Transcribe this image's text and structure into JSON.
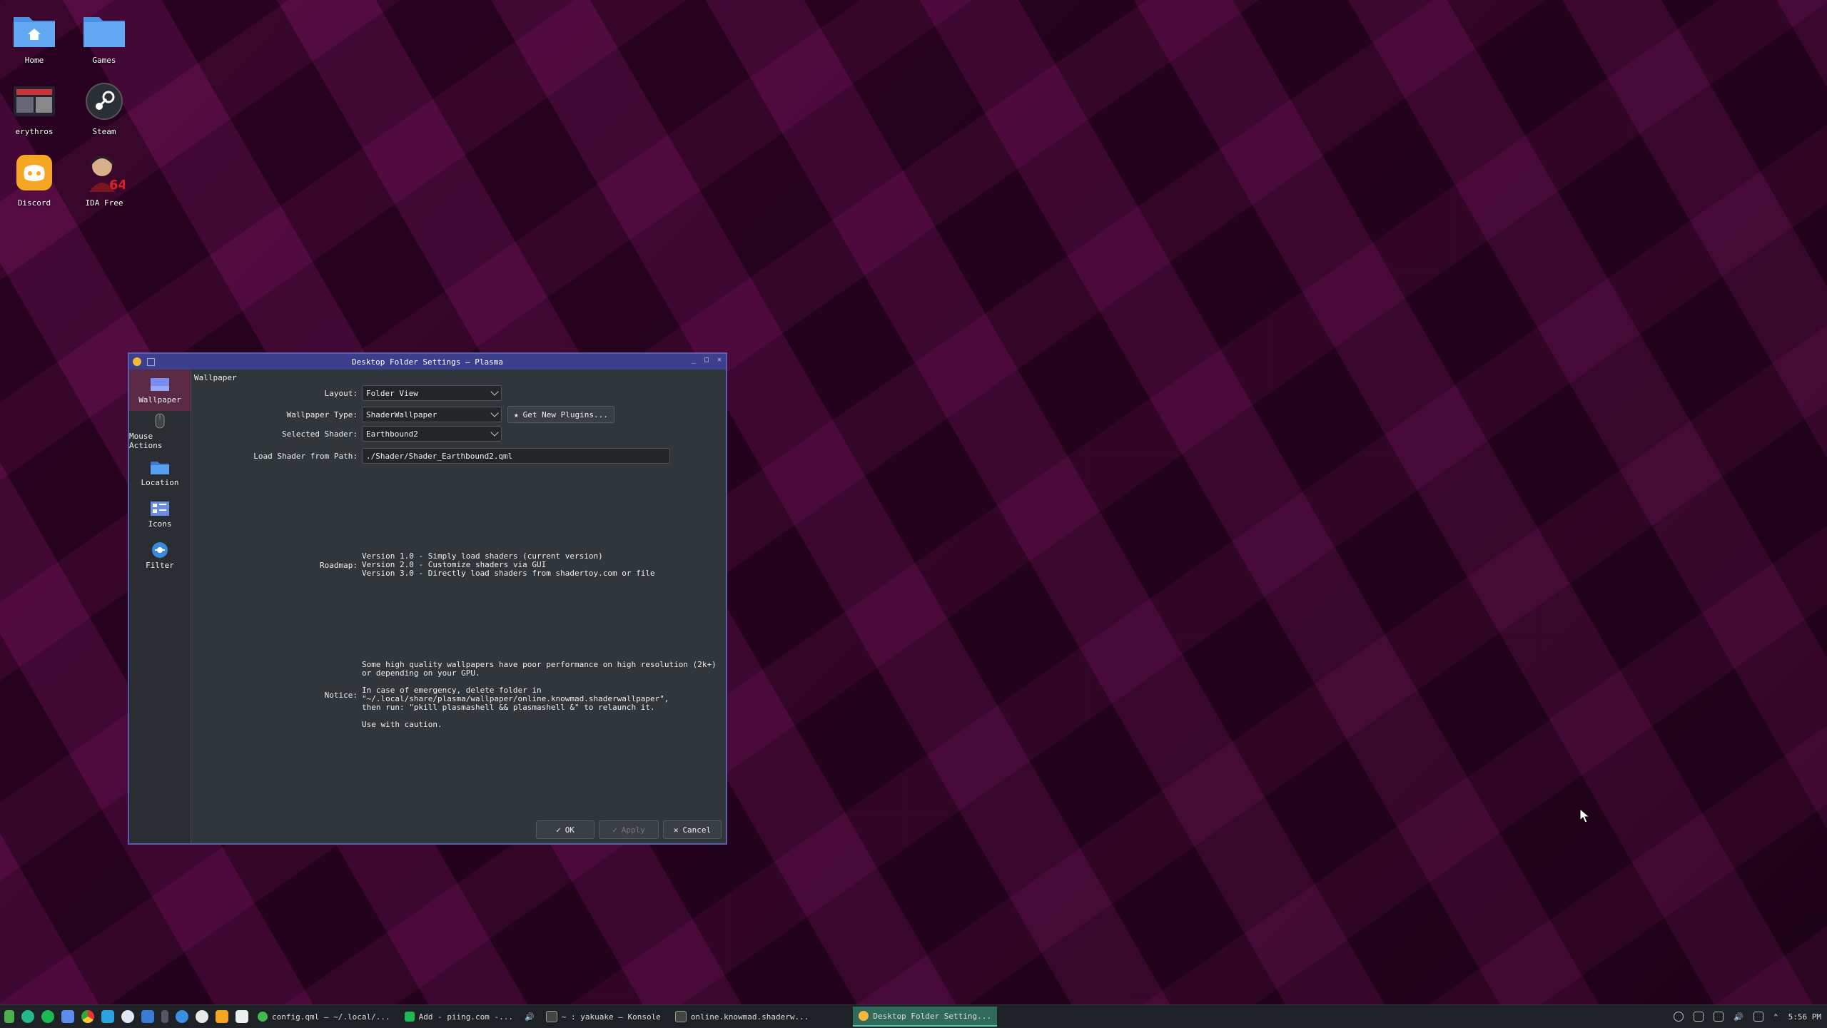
{
  "desktop": {
    "icons": [
      {
        "label": "Home"
      },
      {
        "label": "Games"
      },
      {
        "label": "erythros"
      },
      {
        "label": "Steam"
      },
      {
        "label": "Discord"
      },
      {
        "label": "IDA Free"
      }
    ]
  },
  "window": {
    "title": "Desktop Folder Settings — Plasma",
    "sidebar": [
      {
        "label": "Wallpaper"
      },
      {
        "label": "Mouse Actions"
      },
      {
        "label": "Location"
      },
      {
        "label": "Icons"
      },
      {
        "label": "Filter"
      }
    ],
    "section_title": "Wallpaper",
    "layout": {
      "label": "Layout:",
      "value": "Folder View"
    },
    "wallpaper_type": {
      "label": "Wallpaper Type:",
      "value": "ShaderWallpaper",
      "get_plugins": "Get New Plugins..."
    },
    "selected_shader": {
      "label": "Selected Shader:",
      "value": "Earthbound2"
    },
    "load_path": {
      "label": "Load Shader from Path:",
      "value": "./Shader/Shader_Earthbound2.qml"
    },
    "roadmap": {
      "label": "Roadmap:",
      "lines": [
        "Version 1.0 - Simply load shaders (current version)",
        "Version 2.0 - Customize shaders via GUI",
        "Version 3.0 - Directly load shaders from shadertoy.com or file"
      ]
    },
    "notice": {
      "label": "Notice:",
      "lines": [
        "Some high quality wallpapers have poor performance on high resolution (2k+)",
        "or depending on your GPU.",
        "",
        "In case of emergency, delete folder in",
        "\"~/.local/share/plasma/wallpaper/online.knowmad.shaderwallpaper\",",
        "then run: \"pkill plasmashell && plasmashell &\" to relaunch it.",
        "",
        "Use with caution."
      ]
    },
    "buttons": {
      "ok": "OK",
      "apply": "Apply",
      "cancel": "Cancel"
    }
  },
  "taskbar": {
    "tasks": [
      {
        "label": "config.qml — ~/.local/..."
      },
      {
        "label": "Add - piing.com -..."
      },
      {
        "label": "~ : yakuake — Konsole"
      },
      {
        "label": "online.knowmad.shaderw..."
      },
      {
        "label": "Desktop Folder Setting..."
      }
    ],
    "clock": "5:56 PM"
  },
  "colors": {
    "window_bg": "#31363b",
    "titlebar": "#3c3f8c",
    "active_sidebar": "#5a2a45",
    "active_task": "#2f6a5a"
  }
}
